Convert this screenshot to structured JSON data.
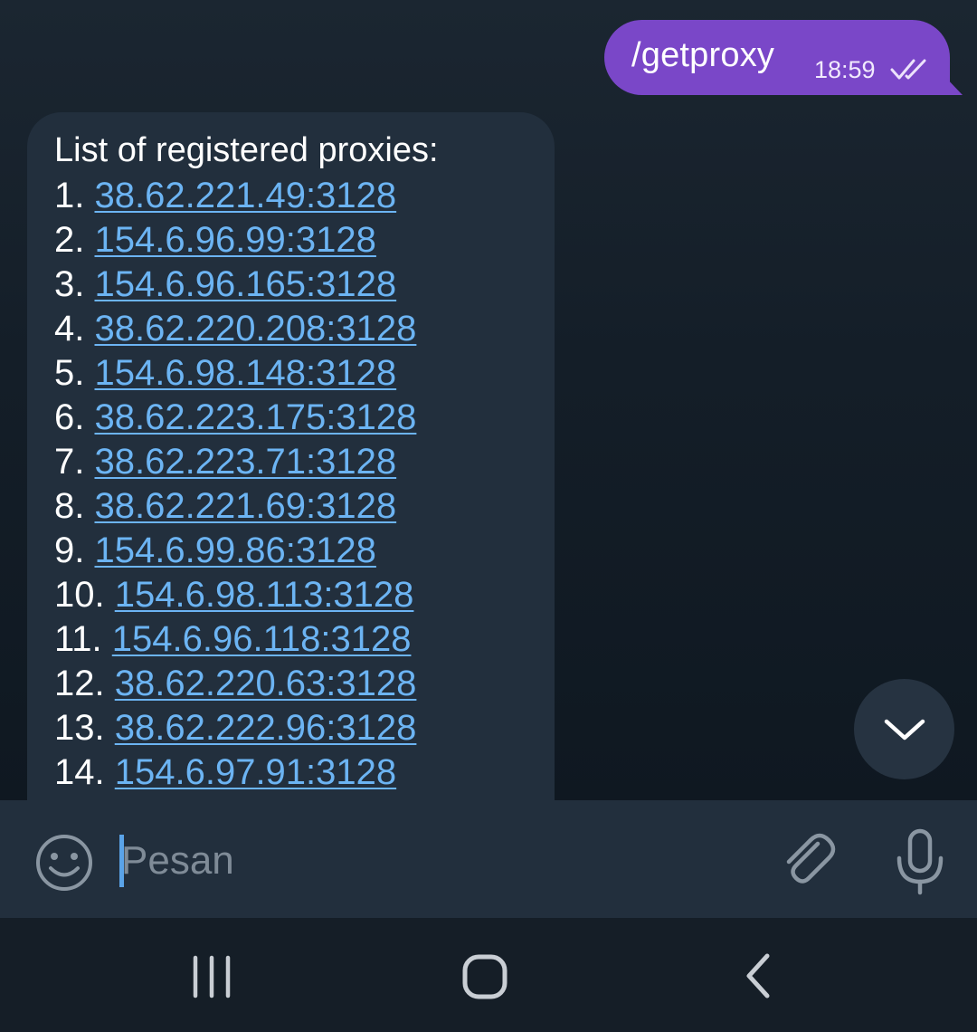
{
  "outgoing": {
    "text": "/getproxy",
    "time": "18:59",
    "status_icon": "double-check-icon"
  },
  "incoming": {
    "title": "List of registered proxies:",
    "proxies": [
      {
        "num": "1.",
        "addr": "38.62.221.49:3128"
      },
      {
        "num": "2.",
        "addr": "154.6.96.99:3128"
      },
      {
        "num": "3.",
        "addr": "154.6.96.165:3128"
      },
      {
        "num": "4.",
        "addr": "38.62.220.208:3128"
      },
      {
        "num": "5.",
        "addr": "154.6.98.148:3128"
      },
      {
        "num": "6.",
        "addr": "38.62.223.175:3128"
      },
      {
        "num": "7.",
        "addr": "38.62.223.71:3128"
      },
      {
        "num": "8.",
        "addr": "38.62.221.69:3128"
      },
      {
        "num": "9.",
        "addr": "154.6.99.86:3128"
      },
      {
        "num": "10.",
        "addr": "154.6.98.113:3128"
      },
      {
        "num": "11.",
        "addr": "154.6.96.118:3128"
      },
      {
        "num": "12.",
        "addr": "38.62.220.63:3128"
      },
      {
        "num": "13.",
        "addr": "38.62.222.96:3128"
      },
      {
        "num": "14.",
        "addr": "154.6.97.91:3128"
      }
    ]
  },
  "input": {
    "placeholder": "Pesan",
    "value": ""
  },
  "icons": {
    "emoji": "emoji-icon",
    "attach": "paperclip-icon",
    "mic": "microphone-icon",
    "scroll_down": "chevron-down-icon",
    "nav_recents": "recents-icon",
    "nav_home": "home-icon",
    "nav_back": "back-icon"
  },
  "colors": {
    "outgoing_bubble": "#7a47c8",
    "incoming_bubble": "#222f3d",
    "link": "#6cb4f3",
    "background": "#141e28",
    "caret": "#5aa3e8"
  }
}
